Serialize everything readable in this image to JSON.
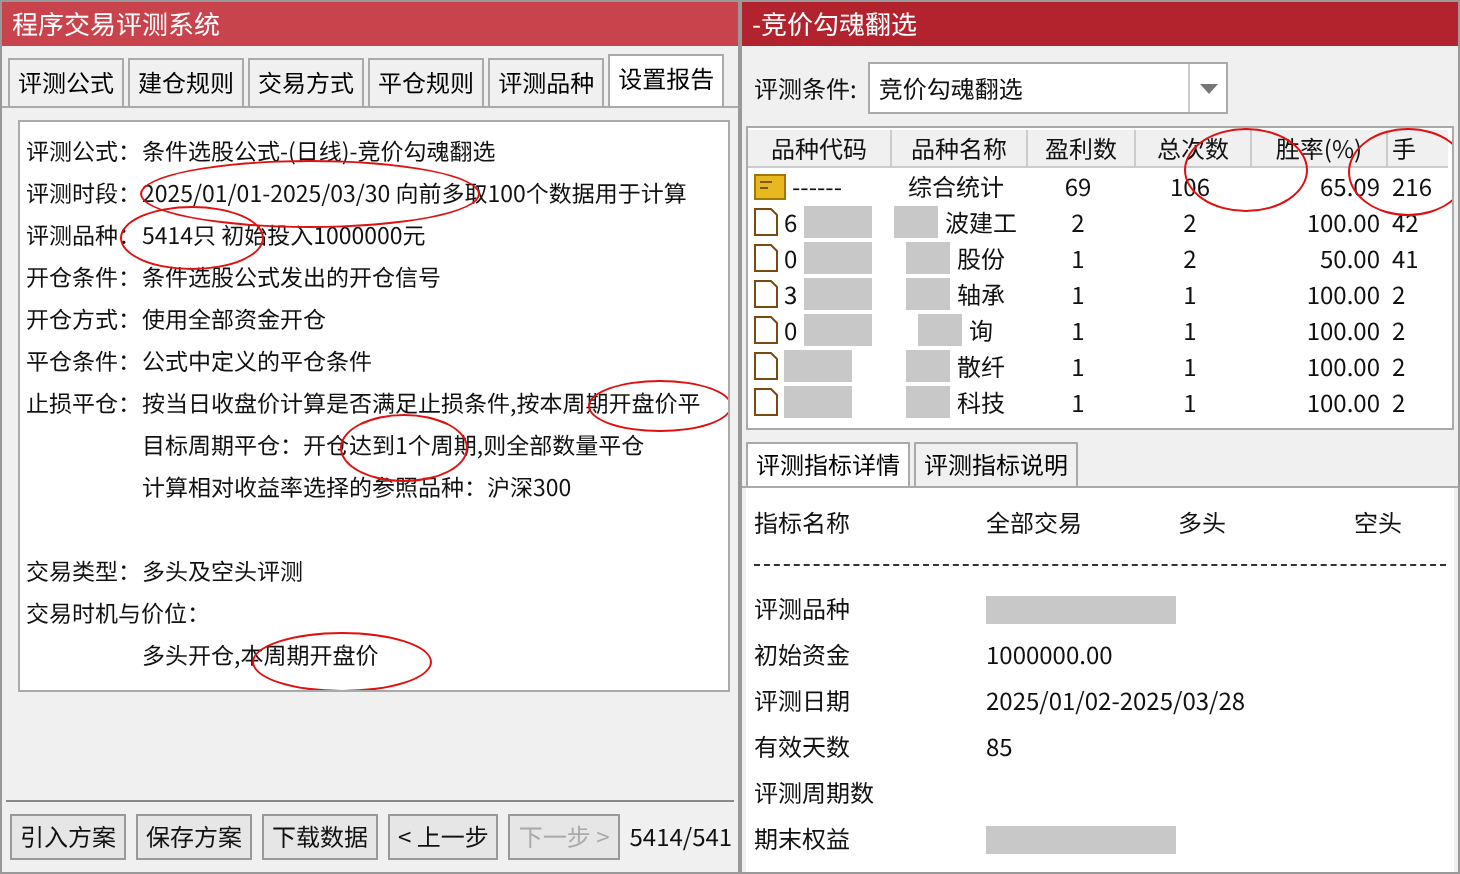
{
  "left_window": {
    "title": "程序交易评测系统",
    "tabs": [
      {
        "label": "评测公式",
        "selected": false
      },
      {
        "label": "建仓规则",
        "selected": false
      },
      {
        "label": "交易方式",
        "selected": false
      },
      {
        "label": "平仓规则",
        "selected": false
      },
      {
        "label": "评测品种",
        "selected": false
      },
      {
        "label": "设置报告",
        "selected": true
      }
    ],
    "report_lines": [
      {
        "kind": "entry",
        "label": "评测公式：",
        "text": "条件选股公式-(日线)-竞价勾魂翻选"
      },
      {
        "kind": "entry",
        "label": "评测时段：",
        "text": "2025/01/01-2025/03/30 向前多取100个数据用于计算"
      },
      {
        "kind": "entry",
        "label": "评测品种：",
        "text": "5414只 初始投入1000000元"
      },
      {
        "kind": "entry",
        "label": "开仓条件：",
        "text": "条件选股公式发出的开仓信号"
      },
      {
        "kind": "entry",
        "label": "开仓方式：",
        "text": "使用全部资金开仓"
      },
      {
        "kind": "entry",
        "label": "平仓条件：",
        "text": "公式中定义的平仓条件"
      },
      {
        "kind": "entry",
        "label": "止损平仓：",
        "text": "按当日收盘价计算是否满足止损条件,按本周期开盘价平"
      },
      {
        "kind": "sub",
        "text": "目标周期平仓：开仓达到1个周期,则全部数量平仓"
      },
      {
        "kind": "sub",
        "text": "计算相对收益率选择的参照品种：沪深300"
      },
      {
        "kind": "spacer"
      },
      {
        "kind": "entry",
        "label": "交易类型：",
        "text": "多头及空头评测"
      },
      {
        "kind": "heading",
        "label": "交易时机与价位："
      },
      {
        "kind": "sub",
        "text": "多头开仓,本周期开盘价"
      }
    ],
    "buttons": [
      {
        "label": "引入方案",
        "disabled": false
      },
      {
        "label": "保存方案",
        "disabled": false
      },
      {
        "label": "下载数据",
        "disabled": false
      },
      {
        "label": "< 上一步",
        "disabled": false
      },
      {
        "label": "下一步 >",
        "disabled": true
      }
    ],
    "progress": "5414/541"
  },
  "right_window": {
    "title": "-竞价勾魂翻选",
    "condition_label": "评测条件:",
    "condition_value": "竞价勾魂翻选",
    "table": {
      "columns": [
        "品种代码",
        "品种名称",
        "盈利数",
        "总次数",
        "胜率(%)",
        "手"
      ],
      "rows": [
        {
          "kind": "summary",
          "cells": [
            "------",
            "综合统计",
            "69",
            "106",
            "65.09",
            "216"
          ]
        },
        {
          "kind": "stock",
          "cells": [
            "6",
            "波建工",
            "2",
            "2",
            "100.00",
            "42"
          ]
        },
        {
          "kind": "stock",
          "cells": [
            "0",
            "股份",
            "1",
            "2",
            "50.00",
            "41"
          ]
        },
        {
          "kind": "stock",
          "cells": [
            "3",
            "轴承",
            "1",
            "1",
            "100.00",
            "2"
          ]
        },
        {
          "kind": "stock",
          "cells": [
            "0",
            "询",
            "1",
            "1",
            "100.00",
            "2"
          ]
        },
        {
          "kind": "stock",
          "cells": [
            null,
            "散纤",
            "1",
            "1",
            "100.00",
            "2"
          ]
        },
        {
          "kind": "stock",
          "cells": [
            null,
            "科技",
            "1",
            "1",
            "100.00",
            "2"
          ]
        }
      ]
    },
    "detail_tabs": [
      {
        "label": "评测指标详情",
        "selected": true
      },
      {
        "label": "评测指标说明",
        "selected": false
      }
    ],
    "detail_header": [
      "指标名称",
      "全部交易",
      "多头",
      "空头"
    ],
    "detail_rows": [
      {
        "label": "评测品种",
        "blurred": true
      },
      {
        "label": "初始资金",
        "value": "1000000.00"
      },
      {
        "label": "评测日期",
        "value": "2025/01/02-2025/03/28"
      },
      {
        "label": "有效天数",
        "value": "85"
      },
      {
        "label": "评测周期数"
      },
      {
        "label": "期末权益",
        "blurred": true
      }
    ]
  }
}
